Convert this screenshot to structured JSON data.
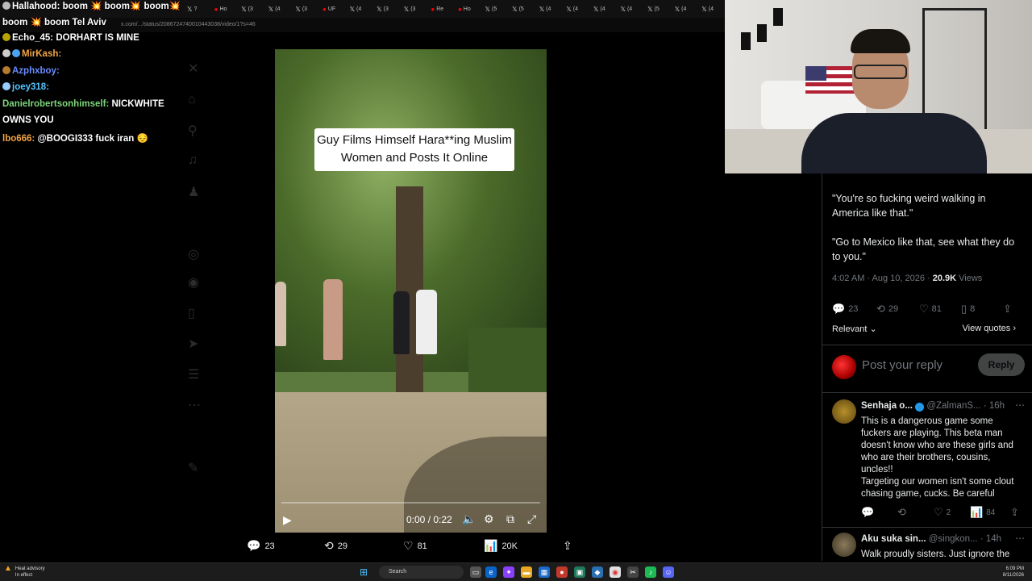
{
  "browser": {
    "tabs": [
      "?",
      "Ho",
      "(3",
      "(4",
      "(3",
      "UF",
      "(4",
      "(3",
      "(3",
      "Re",
      "Ho",
      "(5",
      "(5",
      "(4",
      "(4",
      "(4",
      "(4",
      "(5",
      "(4",
      "(4"
    ],
    "url": "x.com/.../status/2086724740010443038/video/1?s=46"
  },
  "chat": [
    {
      "name": "Hallahood:",
      "text": "boom 💥 boom💥 boom💥"
    },
    {
      "name": "",
      "text": "boom 💥 boom Tel Aviv"
    },
    {
      "name": "Echo_45:",
      "text": "DORHART IS MINE"
    },
    {
      "name": "MirKash:",
      "text": ""
    },
    {
      "name": "Azphxboy:",
      "text": ""
    },
    {
      "name": "joey318:",
      "text": ""
    },
    {
      "name": "Danielrobertsonhimself:",
      "text": "NICKWHITE"
    },
    {
      "name": "",
      "text": "OWNS YOU"
    },
    {
      "name": "lbo666:",
      "text": "@BOOGI333 fuck iran 😔"
    }
  ],
  "video": {
    "caption_line1": "Guy Films Himself Hara**ing Muslim",
    "caption_line2": "Women and Posts It Online",
    "time": "0:00 / 0:22",
    "progress": 0
  },
  "video_actions": {
    "replies": "23",
    "reposts": "29",
    "likes": "81",
    "views": "20K"
  },
  "tweet": {
    "text1": "\"You're so fucking weird walking in America like that.\"",
    "text2": "\"Go to Mexico like that, see what they do to you.\"",
    "time": "4:02 AM · Aug 10, 2026 · ",
    "views_count": "20.9K",
    "views_label": " Views",
    "stats": {
      "replies": "23",
      "reposts": "29",
      "likes": "81",
      "bookmarks": "8"
    },
    "relevant_label": "Relevant",
    "view_quotes_label": "View quotes",
    "reply_placeholder": "Post your reply",
    "reply_button": "Reply"
  },
  "replies": [
    {
      "name": "Senhaja o...",
      "handle": "@ZalmanS...",
      "age": "· 16h",
      "text1": "This is a dangerous game some fuckers are playing. This beta man doesn't know who are these girls and who are their brothers, cousins, uncles!!",
      "text2": "Targeting our women isn't some clout chasing game, cucks. Be careful",
      "likes": "2",
      "views": "84"
    },
    {
      "name": "Aku suka sin...",
      "handle": "@singkon...",
      "age": "· 14h",
      "text1": "Walk proudly sisters. Just ignore the"
    }
  ],
  "taskbar": {
    "weather_title": "Heat advisory",
    "weather_sub": "In effect",
    "search": "Search",
    "time": "6:09 PM",
    "date": "8/11/2026"
  },
  "colors": {
    "accent": "#1d9bf0",
    "background": "#000000",
    "muted": "#71767b"
  },
  "icons": [
    "play-icon",
    "volume-icon",
    "settings-icon",
    "fullscreen-icon",
    "reply-icon",
    "repost-icon",
    "like-icon",
    "views-icon",
    "share-icon",
    "bookmark-icon"
  ]
}
